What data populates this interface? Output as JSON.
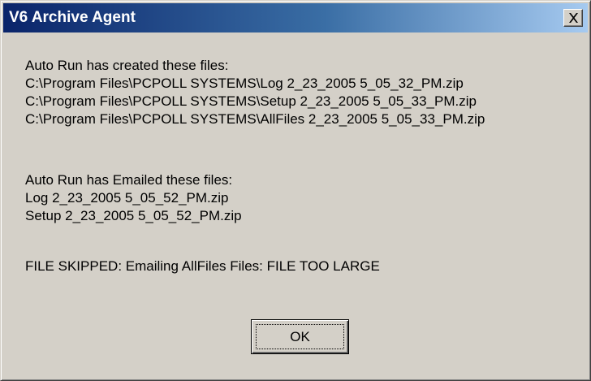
{
  "window": {
    "title": "V6 Archive Agent",
    "close_icon": "close-icon"
  },
  "message": {
    "created_heading": "Auto Run has created these files:",
    "created_files": [
      "C:\\Program Files\\PCPOLL SYSTEMS\\Log 2_23_2005 5_05_32_PM.zip",
      "C:\\Program Files\\PCPOLL SYSTEMS\\Setup 2_23_2005 5_05_33_PM.zip",
      "C:\\Program Files\\PCPOLL SYSTEMS\\AllFiles 2_23_2005 5_05_33_PM.zip"
    ],
    "emailed_heading": "Auto Run has Emailed these files:",
    "emailed_files": [
      "Log 2_23_2005 5_05_52_PM.zip",
      "Setup 2_23_2005 5_05_52_PM.zip"
    ],
    "skipped_text": "FILE SKIPPED: Emailing AllFiles Files: FILE TOO LARGE"
  },
  "buttons": {
    "ok_label": "OK"
  },
  "colors": {
    "titlebar_start": "#0a246a",
    "titlebar_end": "#a6caf0",
    "face": "#d4d0c8"
  }
}
